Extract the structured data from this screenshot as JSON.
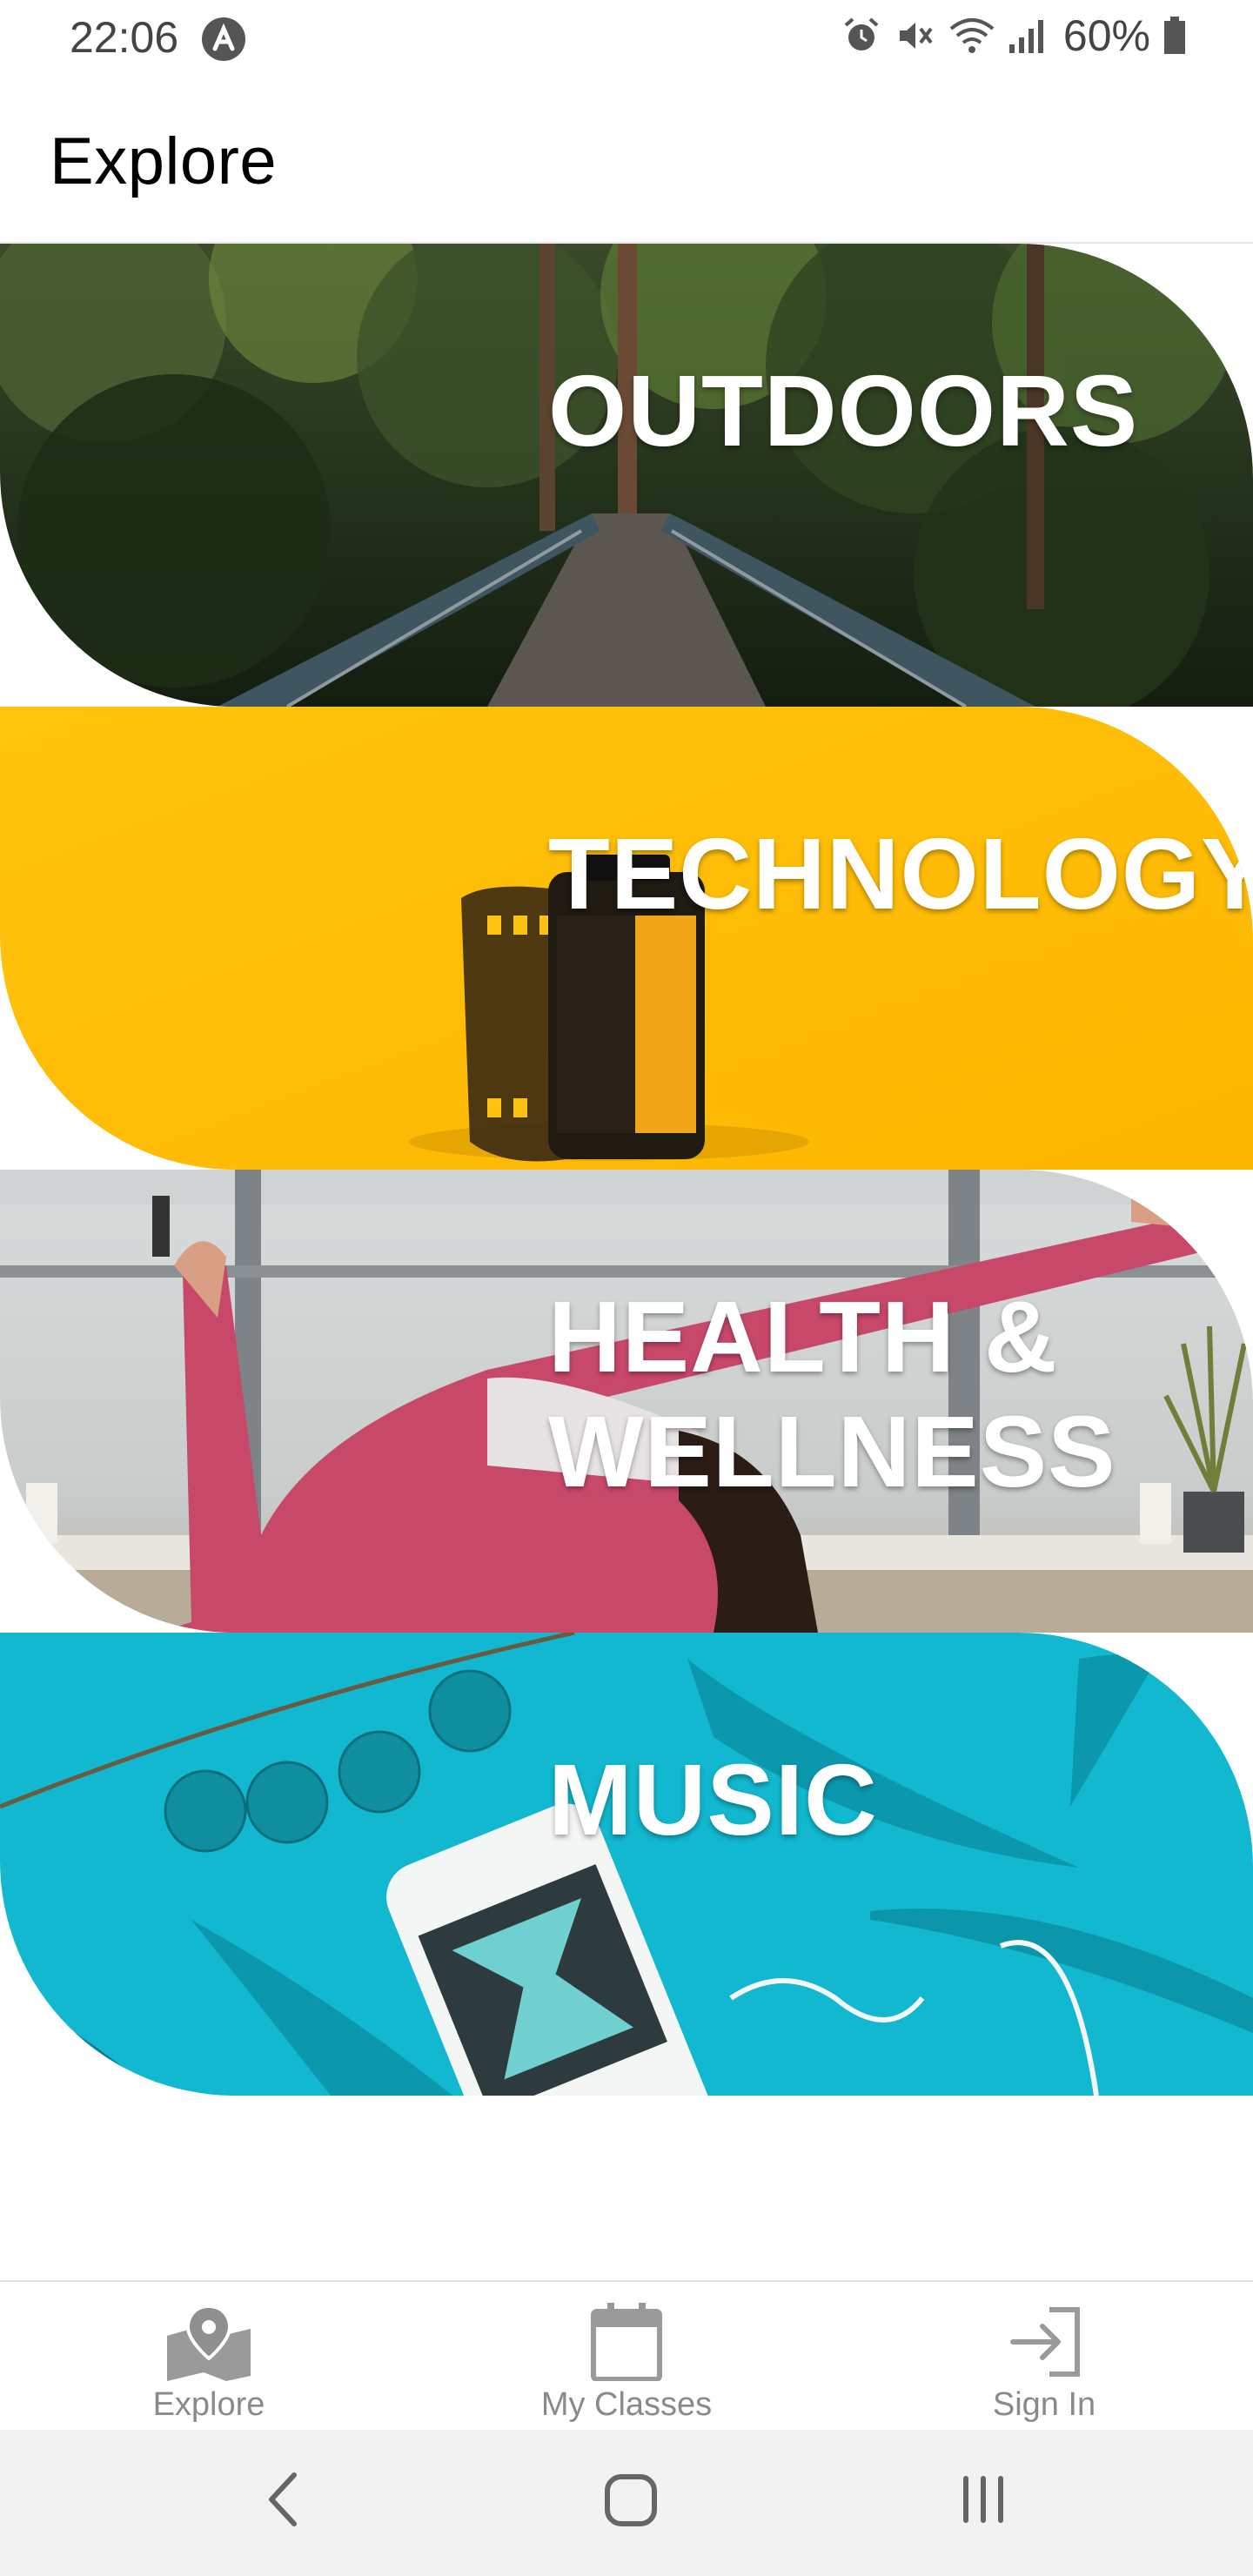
{
  "status_bar": {
    "time": "22:06",
    "battery": "60%",
    "icons": [
      "app-notification-icon",
      "alarm-icon",
      "mute-icon",
      "wifi-icon",
      "signal-icon",
      "battery-icon"
    ]
  },
  "header": {
    "title": "Explore"
  },
  "categories": [
    {
      "label": "OUTDOORS",
      "image": "forest-bridge-photo"
    },
    {
      "label": "TECHNOLOGY",
      "image": "film-canister-photo"
    },
    {
      "label_line1": "HEALTH &",
      "label_line2": "WELLNESS",
      "image": "yoga-pose-photo"
    },
    {
      "label": "MUSIC",
      "image": "phone-feathers-photo"
    }
  ],
  "bottom_nav": {
    "items": [
      {
        "label": "Explore",
        "icon": "map-pin-icon"
      },
      {
        "label": "My Classes",
        "icon": "calendar-icon"
      },
      {
        "label": "Sign In",
        "icon": "sign-in-icon"
      }
    ]
  },
  "system_nav": {
    "buttons": [
      "back-icon",
      "home-icon",
      "recents-icon"
    ]
  },
  "colors": {
    "technology_bg": "#FDC114",
    "music_bg": "#12B8CF",
    "nav_icon": "#9a9a9a"
  }
}
